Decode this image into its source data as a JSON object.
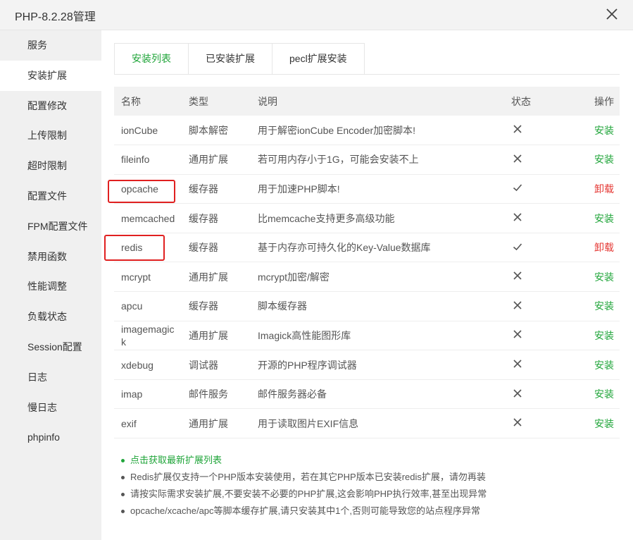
{
  "window": {
    "title": "PHP-8.2.28管理"
  },
  "sidebar": {
    "items": [
      {
        "label": "服务"
      },
      {
        "label": "安装扩展"
      },
      {
        "label": "配置修改"
      },
      {
        "label": "上传限制"
      },
      {
        "label": "超时限制"
      },
      {
        "label": "配置文件"
      },
      {
        "label": "FPM配置文件"
      },
      {
        "label": "禁用函数"
      },
      {
        "label": "性能调整"
      },
      {
        "label": "负载状态"
      },
      {
        "label": "Session配置"
      },
      {
        "label": "日志"
      },
      {
        "label": "慢日志"
      },
      {
        "label": "phpinfo"
      }
    ],
    "active_index": 1
  },
  "tabs": [
    {
      "label": "安装列表"
    },
    {
      "label": "已安装扩展"
    },
    {
      "label": "pecl扩展安装"
    }
  ],
  "table": {
    "headers": {
      "name": "名称",
      "type": "类型",
      "desc": "说明",
      "status": "状态",
      "op": "操作"
    },
    "rows": [
      {
        "name": "ionCube",
        "type": "脚本解密",
        "desc": "用于解密ionCube Encoder加密脚本!",
        "status": "✕",
        "op": "安装",
        "installed": false
      },
      {
        "name": "fileinfo",
        "type": "通用扩展",
        "desc": "若可用内存小于1G，可能会安装不上",
        "status": "✕",
        "op": "安装",
        "installed": false
      },
      {
        "name": "opcache",
        "type": "缓存器",
        "desc": "用于加速PHP脚本!",
        "status": "✓",
        "op": "卸载",
        "installed": true
      },
      {
        "name": "memcached",
        "type": "缓存器",
        "desc": "比memcache支持更多高级功能",
        "status": "✕",
        "op": "安装",
        "installed": false
      },
      {
        "name": "redis",
        "type": "缓存器",
        "desc": "基于内存亦可持久化的Key-Value数据库",
        "status": "✓",
        "op": "卸载",
        "installed": true
      },
      {
        "name": "mcrypt",
        "type": "通用扩展",
        "desc": "mcrypt加密/解密",
        "status": "✕",
        "op": "安装",
        "installed": false
      },
      {
        "name": "apcu",
        "type": "缓存器",
        "desc": "脚本缓存器",
        "status": "✕",
        "op": "安装",
        "installed": false
      },
      {
        "name": "imagemagick",
        "name_line1": "imagemagic",
        "name_line2": "k",
        "type": "通用扩展",
        "desc": "Imagick高性能图形库",
        "status": "✕",
        "op": "安装",
        "installed": false
      },
      {
        "name": "xdebug",
        "type": "调试器",
        "desc": "开源的PHP程序调试器",
        "status": "✕",
        "op": "安装",
        "installed": false
      },
      {
        "name": "imap",
        "type": "邮件服务",
        "desc": "邮件服务器必备",
        "status": "✕",
        "op": "安装",
        "installed": false
      },
      {
        "name": "exif",
        "type": "通用扩展",
        "desc": "用于读取图片EXIF信息",
        "status": "✕",
        "op": "安装",
        "installed": false
      }
    ]
  },
  "tips": [
    {
      "text": "点击获取最新扩展列表",
      "link": true
    },
    {
      "text": "Redis扩展仅支持一个PHP版本安装使用，若在其它PHP版本已安装redis扩展，请勿再装",
      "link": false
    },
    {
      "text": "请按实际需求安装扩展,不要安装不必要的PHP扩展,这会影响PHP执行效率,甚至出现异常",
      "link": false
    },
    {
      "text": "opcache/xcache/apc等脚本缓存扩展,请只安装其中1个,否则可能导致您的站点程序异常",
      "link": false
    }
  ],
  "colors": {
    "accent": "#20a53a",
    "danger": "#e53935",
    "highlight": "#e02020"
  },
  "icons": {
    "close": "close-icon",
    "installed": "check-icon",
    "not_installed": "cross-icon"
  }
}
